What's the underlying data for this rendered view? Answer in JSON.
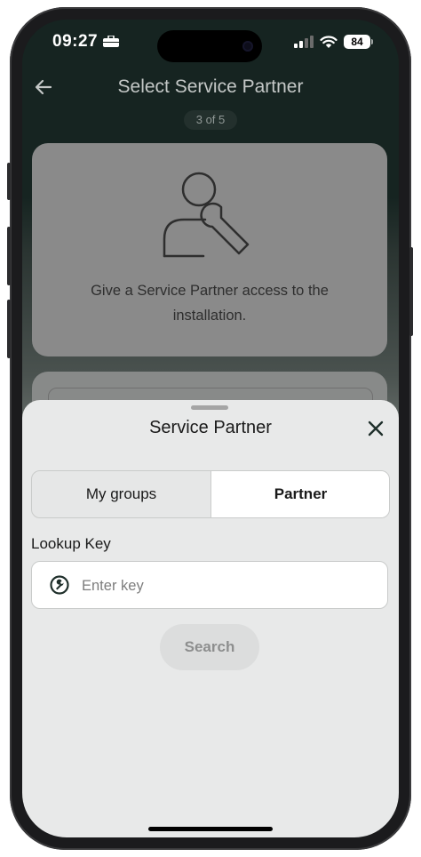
{
  "status_bar": {
    "time": "09:27",
    "battery": "84"
  },
  "header": {
    "title": "Select Service Partner",
    "step": "3 of 5"
  },
  "info_card": {
    "text": "Give a Service Partner access to the installation."
  },
  "sheet": {
    "title": "Service Partner",
    "tabs": [
      {
        "label": "My groups",
        "selected": false
      },
      {
        "label": "Partner",
        "selected": true
      }
    ],
    "lookup_label": "Lookup Key",
    "key_placeholder": "Enter key",
    "key_value": "",
    "search_label": "Search"
  },
  "icons": {
    "back": "arrow-left-icon",
    "close": "close-icon",
    "key": "wrench-icon",
    "person": "person-wrench-icon"
  },
  "colors": {
    "header_bg": "#162421",
    "sheet_bg": "#e8e9e9",
    "accent_dark": "#1f2f2b"
  }
}
